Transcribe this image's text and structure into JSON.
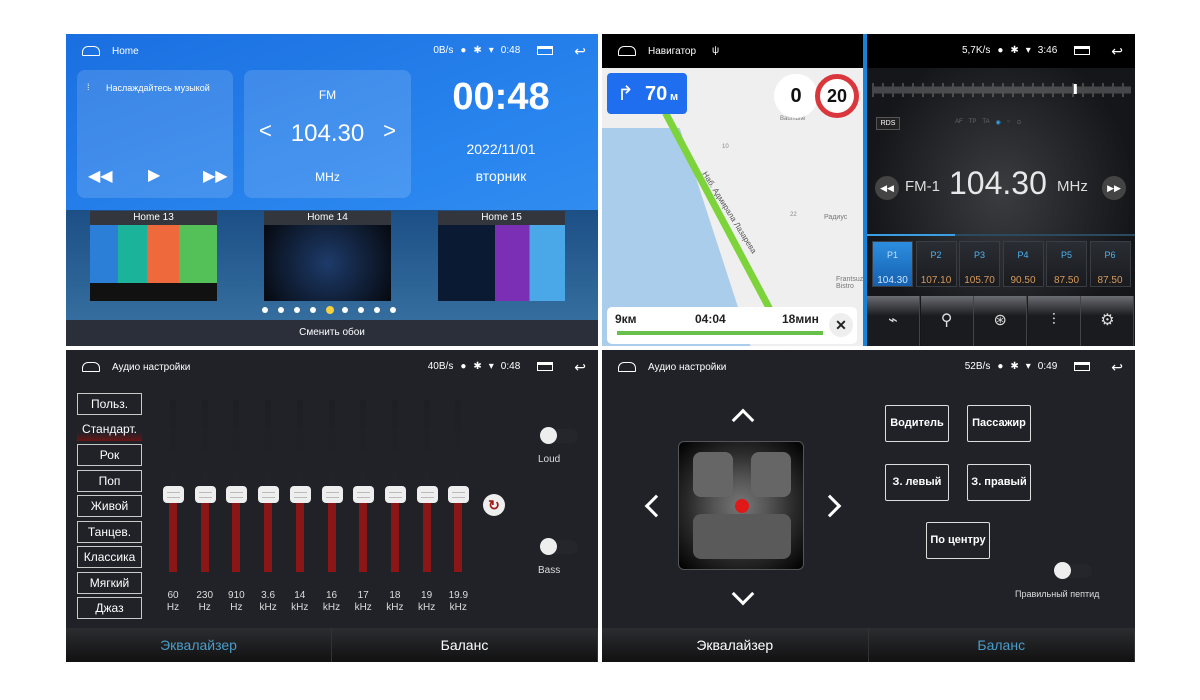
{
  "home": {
    "status": {
      "title": "Home",
      "speed": "0B/s",
      "time": "0:48"
    },
    "music_widget": {
      "label": "Наслаждайтесь музыкой"
    },
    "radio_widget": {
      "band": "FM",
      "frequency": "104.30",
      "unit": "MHz"
    },
    "clock": {
      "time": "00:48",
      "date": "2022/11/01",
      "weekday": "вторник"
    },
    "themes": [
      {
        "label": "Home 13"
      },
      {
        "label": "Home 14"
      },
      {
        "label": "Home 15"
      }
    ],
    "page_dots": {
      "count": 9,
      "active_index": 4
    },
    "change_wallpaper": "Сменить обои"
  },
  "navigator": {
    "status": {
      "title": "Навигатор"
    },
    "turn": {
      "distance": "70",
      "unit": "м"
    },
    "speed": {
      "current": "0",
      "limit": "20"
    },
    "map_labels": [
      "Наб. Адмирала Лазарева",
      "Радиус",
      "Frantsuz Bistro",
      "Baumbite",
      "10",
      "22"
    ],
    "route": {
      "distance": "9км",
      "eta": "04:04",
      "duration": "18мин"
    }
  },
  "radio": {
    "status": {
      "speed": "5,7K/s",
      "time": "3:46"
    },
    "rds": "RDS",
    "flags": [
      "AF",
      "TP",
      "TA"
    ],
    "band": "FM-1",
    "frequency": "104.30",
    "unit": "MHz",
    "tuning_position": 0.78,
    "presets": [
      {
        "name": "P1",
        "freq": "104.30",
        "active": true
      },
      {
        "name": "P2",
        "freq": "107.10"
      },
      {
        "name": "P3",
        "freq": "105.70"
      },
      {
        "name": "P4",
        "freq": "90.50"
      },
      {
        "name": "P5",
        "freq": "87.50"
      },
      {
        "name": "P6",
        "freq": "87.50"
      }
    ],
    "toolbar": [
      "signal-icon",
      "search-icon",
      "scan-icon",
      "equalizer-icon",
      "settings-icon"
    ]
  },
  "equalizer": {
    "status": {
      "title": "Аудио настройки",
      "speed": "40B/s",
      "time": "0:48"
    },
    "presets": [
      "Польз.",
      "Стандарт.",
      "Рок",
      "Поп",
      "Живой",
      "Танцев.",
      "Классика",
      "Мягкий",
      "Джаз"
    ],
    "selected_preset": "Стандарт.",
    "bands": [
      {
        "freq": "60",
        "unit": "Hz",
        "level": 0.5
      },
      {
        "freq": "230",
        "unit": "Hz",
        "level": 0.5
      },
      {
        "freq": "910",
        "unit": "Hz",
        "level": 0.5
      },
      {
        "freq": "3.6",
        "unit": "kHz",
        "level": 0.5
      },
      {
        "freq": "14",
        "unit": "kHz",
        "level": 0.5
      },
      {
        "freq": "16",
        "unit": "kHz",
        "level": 0.5
      },
      {
        "freq": "17",
        "unit": "kHz",
        "level": 0.5
      },
      {
        "freq": "18",
        "unit": "kHz",
        "level": 0.5
      },
      {
        "freq": "19",
        "unit": "kHz",
        "level": 0.5
      },
      {
        "freq": "19.9",
        "unit": "kHz",
        "level": 0.5
      }
    ],
    "loud": {
      "label": "Loud",
      "on": false
    },
    "bass": {
      "label": "Bass",
      "on": false
    },
    "tabs": {
      "eq": "Эквалайзер",
      "balance": "Баланс",
      "active": "eq"
    },
    "accent": "#4a9cc9"
  },
  "balance": {
    "status": {
      "title": "Аудио настройки",
      "speed": "52B/s",
      "time": "0:49"
    },
    "buttons": {
      "driver": "Водитель",
      "passenger": "Пассажир",
      "rear_left": "З. левый",
      "rear_right": "З. правый",
      "center": "По центру"
    },
    "toggle": {
      "label": "Правильный пептид",
      "on": false
    },
    "tabs": {
      "eq": "Эквалайзер",
      "balance": "Баланс",
      "active": "balance"
    }
  }
}
